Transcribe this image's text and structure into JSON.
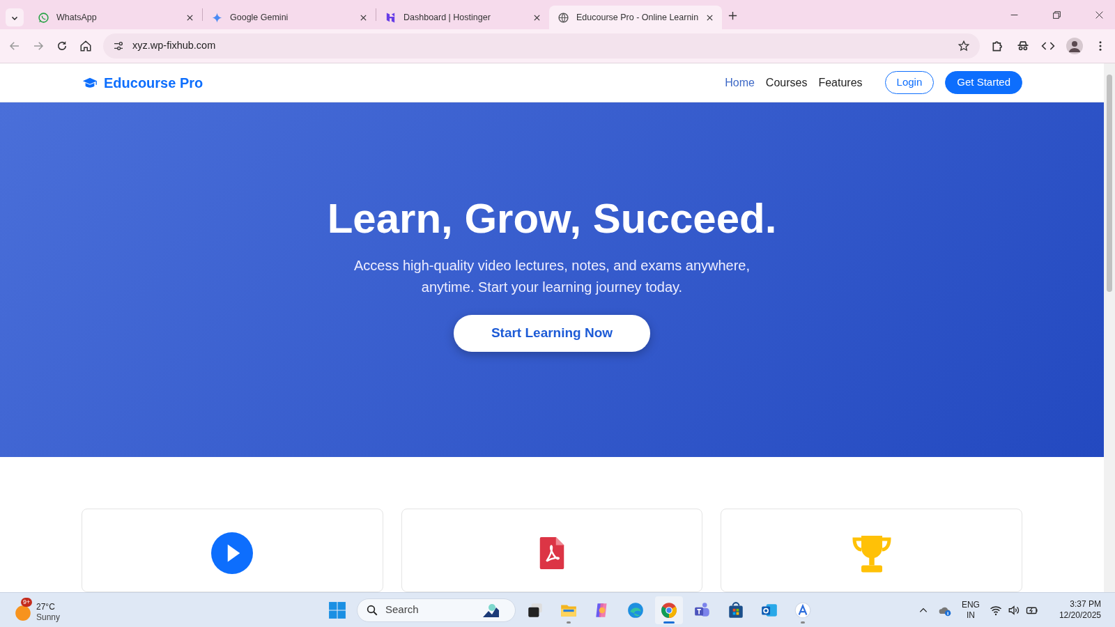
{
  "browser": {
    "tabs": [
      {
        "title": "WhatsApp",
        "kind": "whatsapp",
        "selected": false
      },
      {
        "title": "Google Gemini",
        "kind": "gemini",
        "selected": false
      },
      {
        "title": "Dashboard | Hostinger",
        "kind": "hostinger",
        "selected": false
      },
      {
        "title": "Educourse Pro - Online Learnin",
        "kind": "globe",
        "selected": true
      }
    ],
    "address": "xyz.wp-fixhub.com"
  },
  "site": {
    "brand": "Educourse Pro",
    "nav_links": [
      {
        "label": "Home",
        "selected": true
      },
      {
        "label": "Courses",
        "selected": false
      },
      {
        "label": "Features",
        "selected": false
      }
    ],
    "login": "Login",
    "get_started": "Get Started",
    "hero": {
      "title": "Learn, Grow, Succeed.",
      "subtitle": "Access high-quality video lectures, notes, and exams anywhere, anytime. Start your learning journey today.",
      "cta": "Start Learning Now"
    },
    "features": [
      {
        "kind": "play"
      },
      {
        "kind": "pdf"
      },
      {
        "kind": "trophy"
      }
    ]
  },
  "taskbar": {
    "weather": {
      "badge": "9+",
      "temp": "27°C",
      "condition": "Sunny"
    },
    "search": {
      "placeholder": "Search"
    },
    "apps": [
      {
        "kind": "taskview",
        "selected": false,
        "running": false
      },
      {
        "kind": "explorer",
        "selected": false,
        "running": true
      },
      {
        "kind": "copilot",
        "selected": false,
        "running": false
      },
      {
        "kind": "edge",
        "selected": false,
        "running": false
      },
      {
        "kind": "chrome",
        "selected": true,
        "running": true
      },
      {
        "kind": "teams",
        "selected": false,
        "running": false
      },
      {
        "kind": "store",
        "selected": false,
        "running": false
      },
      {
        "kind": "outlook",
        "selected": false,
        "running": false
      },
      {
        "kind": "appa",
        "selected": false,
        "running": true
      }
    ],
    "language": "ENG",
    "region": "IN",
    "time": "3:37 PM",
    "date": "12/20/2025"
  }
}
